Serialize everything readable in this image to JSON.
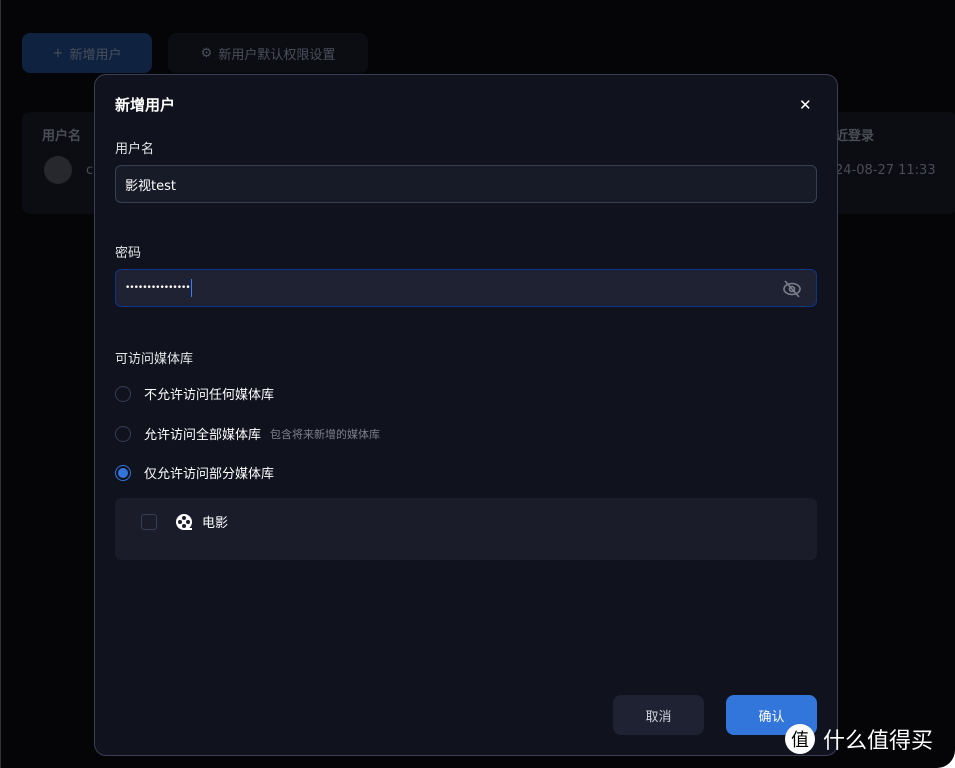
{
  "background": {
    "add_user_label": "新增用户",
    "default_perm_label": "新用户默认权限设置",
    "table": {
      "col_username": "用户名",
      "col_last_login": "近登录",
      "row_username_partial": "c",
      "row_last_login": "24-08-27 11:33"
    }
  },
  "dialog": {
    "title": "新增用户",
    "username_label": "用户名",
    "username_value": "影视test",
    "password_label": "密码",
    "password_value": "•••••••••••••••",
    "library_label": "可访问媒体库",
    "options": [
      {
        "label": "不允许访问任何媒体库",
        "hint": "",
        "selected": false
      },
      {
        "label": "允许访问全部媒体库",
        "hint": "包含将来新增的媒体库",
        "selected": false
      },
      {
        "label": "仅允许访问部分媒体库",
        "hint": "",
        "selected": true
      }
    ],
    "libraries": [
      {
        "name": "电影",
        "checked": false
      }
    ],
    "cancel_label": "取消",
    "confirm_label": "确认"
  },
  "watermark": {
    "logo": "值",
    "text": "什么值得买"
  },
  "colors": {
    "accent": "#3275db",
    "dialog_bg": "#10121d"
  }
}
